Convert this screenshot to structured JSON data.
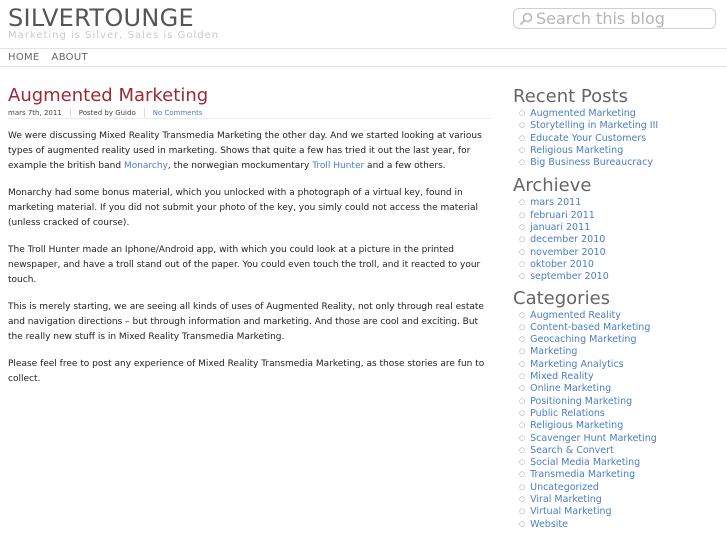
{
  "site": {
    "title": "SILVERTOUNGE",
    "tagline": "Marketing is Silver, Sales is Golden"
  },
  "search": {
    "placeholder": "Search this blog"
  },
  "nav": {
    "items": [
      "HOME",
      "ABOUT"
    ]
  },
  "post": {
    "title": "Augmented Marketing",
    "date": "mars 7th, 2011",
    "author": "Posted by Guido",
    "comments": "No Comments",
    "p1_a": "We were discussing Mixed Reality Transmedia Marketing the other day. And we started looking at various types of augmented reality used in marketing. Shows that quite a few has tried it out the last year, for example the british band ",
    "p1_link1": "Monarchy",
    "p1_b": ", the norwegian mockumentary ",
    "p1_link2": "Troll Hunter",
    "p1_c": " and a few others.",
    "p2": "Monarchy had some bonus material, which you unlocked with a photograph of a virtual key, found in marketing material. If you did not submit your photo of the key, you simly could not access the material (unless cracked of course).",
    "p3": "The Troll Hunter made an Iphone/Android app, with which you could look at a picture in the printed newspaper, and have a troll stand out of the paper. You could even touch the troll, and it reacted to your touch.",
    "p4": "This is merely starting, we are seeing all kinds of uses of Augmented Reality, not only through real estate and navigation directions – but through information and marketing. And those are cool and exciting. But the really new stuff is in Mixed Reality Transmedia Marketing.",
    "p5": "Please feel free to post any experience of Mixed Reality Transmedia Marketing, as those stories are fun to collect."
  },
  "sidebar": {
    "recent_title": "Recent Posts",
    "recent": [
      "Augmented Marketing",
      "Storytelling in Marketing III",
      "Educate Your Customers",
      "Religious Marketing",
      "Big Business Bureaucracy"
    ],
    "archive_title": "Archieve",
    "archive": [
      "mars 2011",
      "februari 2011",
      "januari 2011",
      "december 2010",
      "november 2010",
      "oktober 2010",
      "september 2010"
    ],
    "categories_title": "Categories",
    "categories": [
      "Augmented Reality",
      "Content-based Marketing",
      "Geocaching Marketing",
      "Marketing",
      "Marketing Analytics",
      "Mixed Reality",
      "Online Marketing",
      "Positioning Marketing",
      "Public Relations",
      "Religious Marketing",
      "Scavenger Hunt Marketing",
      "Search & Convert",
      "Social Media Marketing",
      "Transmedia Marketing",
      "Uncategorized",
      "Viral Marketing",
      "Virtual Marketing",
      "Website"
    ]
  }
}
